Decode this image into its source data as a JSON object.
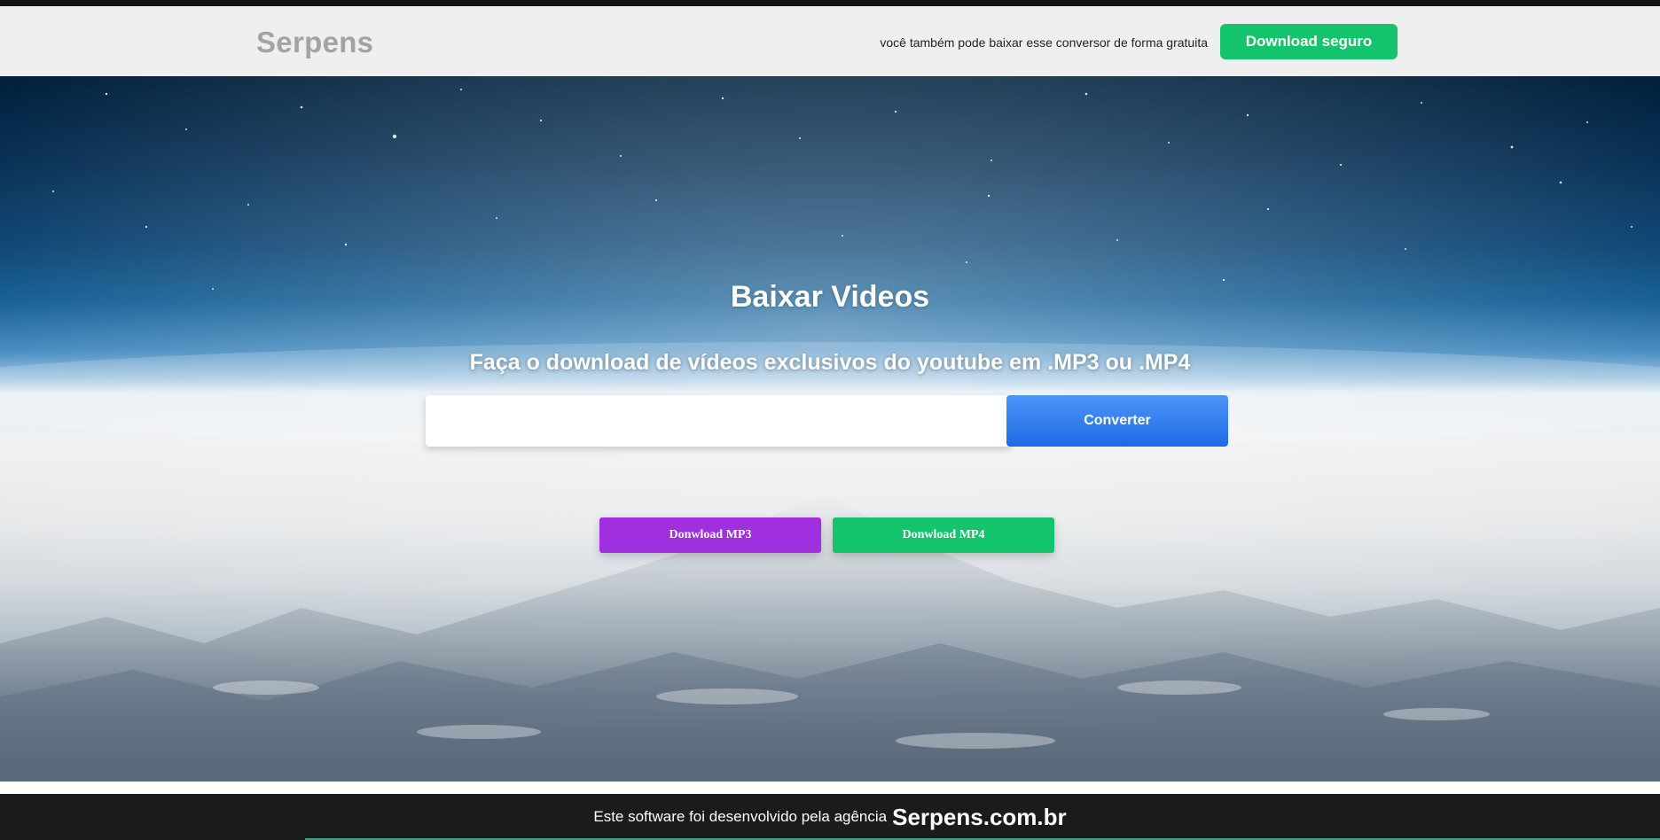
{
  "header": {
    "logo": "Serpens",
    "note": "você também pode baixar esse conversor de forma gratuita",
    "download_button_label": "Download seguro"
  },
  "hero": {
    "title": "Baixar Videos",
    "subtitle": "Faça o download de vídeos exclusivos do youtube em .MP3 ou .MP4",
    "url_input_value": "",
    "url_input_placeholder": "",
    "convert_button_label": "Converter",
    "mp3_button_label": "Donwload MP3",
    "mp4_button_label": "Donwload MP4"
  },
  "footer": {
    "text": "Este software foi desenvolvido pela agência",
    "brand": "Serpens.com.br"
  },
  "colors": {
    "accent_green": "#14c46c",
    "accent_purple": "#a02fdf",
    "accent_blue": "#1e6ae6",
    "footer_bg": "#1b1b1b",
    "header_bg": "#efefef"
  }
}
